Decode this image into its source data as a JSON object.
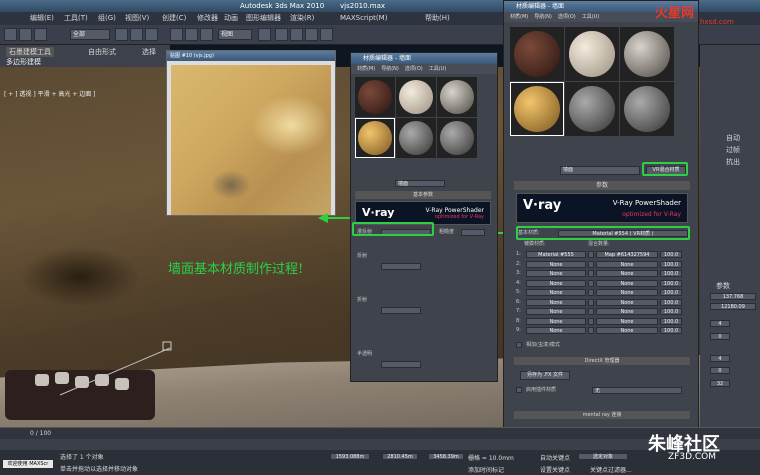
{
  "titlebar": {
    "title": "Autodesk 3ds Max 2010",
    "file": "vjs2010.max"
  },
  "menubar": {
    "items": [
      "编辑(E)",
      "工具(T)",
      "组(G)",
      "视图(V)",
      "创建(C)",
      "修改器",
      "动画",
      "图形编辑器",
      "渲染(R)",
      "MAXScript(M)",
      "帮助(H)"
    ]
  },
  "toolbar": {
    "filter": "全部",
    "view": "视图"
  },
  "ribbon": {
    "tabs": [
      "石墨建模工具",
      "自由形式",
      "选择"
    ],
    "sub": "多边形建模"
  },
  "viewport": {
    "label": "[ + ] 透视 ] 平滑 + 高光 + 边面 ]"
  },
  "texwin": {
    "title": "贴图 #10 (vjs.jpg)"
  },
  "small_editor": {
    "title": "材质编辑器 - 墙面",
    "menu": [
      "材质(M)",
      "导航(N)",
      "选项(O)",
      "工具(U)"
    ],
    "material": "墙面",
    "rollout": "基本参数",
    "vray_logo": "V·ray",
    "vray_title": "V-Ray PowerShader",
    "vray_sub": "optimized for V-Ray",
    "diffuse": "漫反射",
    "rough": "粗糙度",
    "reflect": "反射",
    "refract": "折射",
    "translucency": "半透明"
  },
  "big_editor": {
    "title": "材质编辑器 - 墙面",
    "menu": [
      "材质(M)",
      "导航(N)",
      "选项(O)",
      "工具(U)"
    ],
    "material": "墙面",
    "type_btn": "VR混合材质",
    "params": "参数",
    "vray_logo": "V·ray",
    "vray_title": "V-Ray PowerShader",
    "vray_sub": "optimized for V-Ray",
    "base_label": "基本材质:",
    "base_value": "Material #554 ( VR材质 )",
    "coat_header": "镀膜材质:",
    "mix_header": "混合数量:",
    "rows": [
      {
        "n": "1:",
        "coat": "Material #555",
        "mix": "Map #614327594",
        "val": "100.0"
      },
      {
        "n": "2:",
        "coat": "None",
        "mix": "None",
        "val": "100.0"
      },
      {
        "n": "3:",
        "coat": "None",
        "mix": "None",
        "val": "100.0"
      },
      {
        "n": "4:",
        "coat": "None",
        "mix": "None",
        "val": "100.0"
      },
      {
        "n": "5:",
        "coat": "None",
        "mix": "None",
        "val": "100.0"
      },
      {
        "n": "6:",
        "coat": "None",
        "mix": "None",
        "val": "100.0"
      },
      {
        "n": "7:",
        "coat": "None",
        "mix": "None",
        "val": "100.0"
      },
      {
        "n": "8:",
        "coat": "None",
        "mix": "None",
        "val": "100.0"
      },
      {
        "n": "9:",
        "coat": "None",
        "mix": "None",
        "val": "100.0"
      }
    ],
    "additive": "相加(虫漆)模式",
    "directx": "DirectX 管理器",
    "save_fx": "另存为 .FX 文件",
    "enable_plugin": "启用插件材质",
    "plugin_value": "无",
    "mentalray": "mental ray 连接"
  },
  "annotation": "墙面基本材质制作过程!",
  "rightpanel": {
    "labels": [
      "自动",
      "过帧",
      "抗出",
      "参数",
      "137.768",
      "12180.09",
      "4",
      "0",
      "4",
      "0",
      "32"
    ]
  },
  "timeline": {
    "frame": "0 / 100"
  },
  "status": {
    "left_btn": "欢迎使用 MAXScr",
    "msg1": "选择了 1 个对象",
    "msg2": "单击并拖动以选择并移动对象",
    "x": "1593.088m",
    "y": "2810.45m",
    "z": "3458.39m",
    "grid": "栅格 = 10.0mm",
    "autokey": "自动关键点",
    "setkey": "设置关键点",
    "sel": "选定对象",
    "filter": "关键点过滤器...",
    "addtime": "添加时间标记"
  },
  "watermarks": {
    "top": "火星网",
    "top_url": "hxsd.com",
    "bottom": "朱峰社区",
    "bottom_url": "ZF3D.COM"
  }
}
